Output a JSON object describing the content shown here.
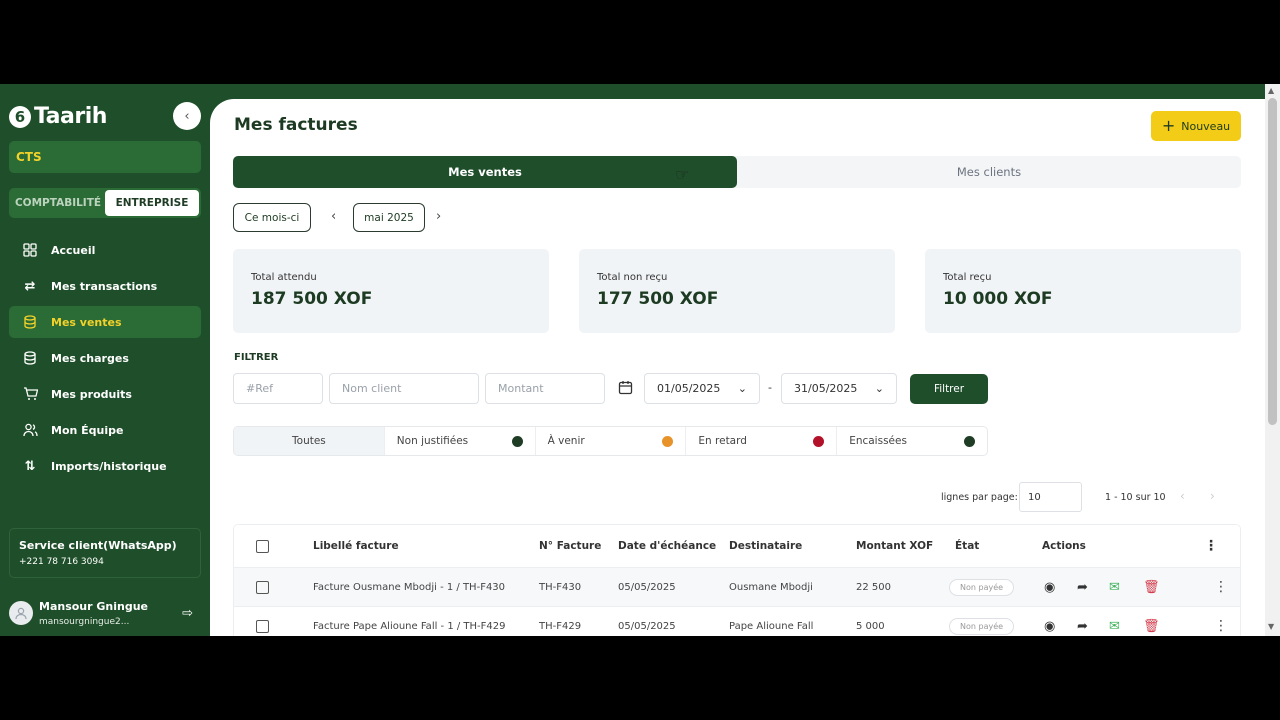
{
  "sidebar": {
    "logo_text": "Taarih",
    "collapse_icon": "chevron-left-icon",
    "company": "CTS",
    "modes": [
      "COMPTABILITÉ",
      "ENTREPRISE"
    ],
    "active_mode": "ENTREPRISE",
    "items": [
      {
        "label": "Accueil",
        "icon": "grid-icon"
      },
      {
        "label": "Mes transactions",
        "icon": "transfer-arrows-icon"
      },
      {
        "label": "Mes ventes",
        "icon": "coins-stack-icon",
        "active": true
      },
      {
        "label": "Mes charges",
        "icon": "database-icon"
      },
      {
        "label": "Mes produits",
        "icon": "cart-icon"
      },
      {
        "label": "Mon Équipe",
        "icon": "users-icon"
      },
      {
        "label": "Imports/historique",
        "icon": "sort-arrows-icon"
      }
    ],
    "service": {
      "title": "Service client(WhatsApp)",
      "phone": "+221 78 716 3094"
    },
    "user": {
      "name": "Mansour Gningue",
      "email": "mansourgningue2..."
    }
  },
  "header": {
    "title": "Mes factures",
    "new_button": "Nouveau"
  },
  "tabs": [
    {
      "label": "Mes ventes",
      "active": true
    },
    {
      "label": "Mes clients",
      "active": false
    }
  ],
  "period": {
    "current_label": "Ce mois-ci",
    "month": "mai 2025"
  },
  "stats": [
    {
      "label": "Total attendu",
      "value": "187 500 XOF"
    },
    {
      "label": "Total non reçu",
      "value": "177 500 XOF"
    },
    {
      "label": "Total reçu",
      "value": "10 000 XOF"
    }
  ],
  "filters": {
    "title": "FILTRER",
    "ref_placeholder": "#Ref",
    "client_placeholder": "Nom client",
    "amount_placeholder": "Montant",
    "date_from": "01/05/2025",
    "date_to": "31/05/2025",
    "separator": "-",
    "button": "Filtrer"
  },
  "status_tabs": [
    {
      "label": "Toutes",
      "color": null
    },
    {
      "label": "Non justifiées",
      "color": "#1f3d24"
    },
    {
      "label": "À venir",
      "color": "#e8932a"
    },
    {
      "label": "En retard",
      "color": "#b3112a"
    },
    {
      "label": "Encaissées",
      "color": "#1f3d24"
    }
  ],
  "pagination": {
    "rows_label": "lignes par page:",
    "rows_value": "10",
    "range": "1 - 10 sur 10"
  },
  "table": {
    "columns": [
      "Libellé facture",
      "N° Facture",
      "Date d'échéance",
      "Destinataire",
      "Montant XOF",
      "État",
      "Actions"
    ],
    "rows": [
      {
        "libelle": "Facture Ousmane Mbodji - 1 / TH-F430",
        "numero": "TH-F430",
        "date": "05/05/2025",
        "destinataire": "Ousmane Mbodji",
        "montant": "22 500",
        "etat": "Non payée"
      },
      {
        "libelle": "Facture Pape Alioune Fall - 1 / TH-F429",
        "numero": "TH-F429",
        "date": "05/05/2025",
        "destinataire": "Pape Alioune Fall",
        "montant": "5 000",
        "etat": "Non payée"
      }
    ]
  },
  "colors": {
    "primary": "#1f4f2a",
    "accent": "#f2cc16",
    "active_text": "#f3d22a"
  }
}
